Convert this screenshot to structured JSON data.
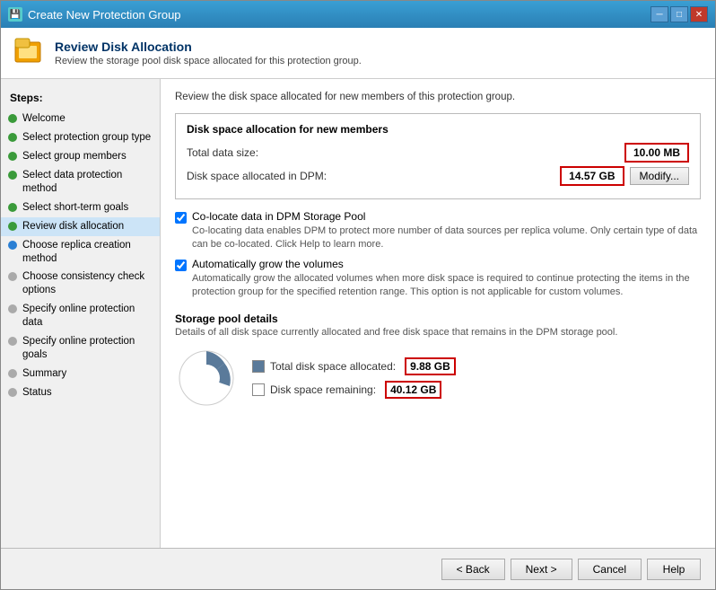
{
  "window": {
    "title": "Create New Protection Group",
    "icon": "💾"
  },
  "header": {
    "title": "Review Disk Allocation",
    "description": "Review the storage pool disk space allocated for this protection group."
  },
  "sidebar": {
    "steps_label": "Steps:",
    "items": [
      {
        "id": "welcome",
        "label": "Welcome",
        "dot": "green",
        "active": false
      },
      {
        "id": "select-protection-group-type",
        "label": "Select protection group type",
        "dot": "green",
        "active": false
      },
      {
        "id": "select-group-members",
        "label": "Select group members",
        "dot": "green",
        "active": false
      },
      {
        "id": "select-data-protection-method",
        "label": "Select data protection method",
        "dot": "green",
        "active": false
      },
      {
        "id": "select-short-term-goals",
        "label": "Select short-term goals",
        "dot": "green",
        "active": false
      },
      {
        "id": "review-disk-allocation",
        "label": "Review disk allocation",
        "dot": "green",
        "active": true
      },
      {
        "id": "choose-replica-creation-method",
        "label": "Choose replica creation method",
        "dot": "blue",
        "active": false
      },
      {
        "id": "choose-consistency-check-options",
        "label": "Choose consistency check options",
        "dot": "grey",
        "active": false
      },
      {
        "id": "specify-online-protection-data",
        "label": "Specify online protection data",
        "dot": "grey",
        "active": false
      },
      {
        "id": "specify-online-protection-goals",
        "label": "Specify online protection goals",
        "dot": "grey",
        "active": false
      },
      {
        "id": "summary",
        "label": "Summary",
        "dot": "grey",
        "active": false
      },
      {
        "id": "status",
        "label": "Status",
        "dot": "grey",
        "active": false
      }
    ]
  },
  "main": {
    "section_desc": "Review the disk space allocated for new members of this protection group.",
    "disk_box": {
      "title": "Disk space allocation for new members",
      "total_data_size_label": "Total data size:",
      "total_data_size_value": "10.00 MB",
      "disk_space_label": "Disk space allocated in DPM:",
      "disk_space_value": "14.57 GB",
      "modify_label": "Modify..."
    },
    "colocate_checkbox": {
      "label": "Co-locate data in DPM Storage Pool",
      "desc": "Co-locating data enables DPM to protect more number of data sources per replica volume. Only certain type of data can be co-located. Click Help to learn more.",
      "checked": true
    },
    "auto_grow_checkbox": {
      "label": "Automatically grow the volumes",
      "desc": "Automatically grow the allocated volumes when more disk space is required to continue protecting the items in the protection group for the specified retention range. This option is not applicable for custom volumes.",
      "checked": true
    },
    "storage_pool": {
      "title": "Storage pool details",
      "desc": "Details of all disk space currently allocated and free disk space that remains in the DPM storage pool.",
      "allocated_label": "Total disk space allocated:",
      "allocated_value": "9.88 GB",
      "remaining_label": "Disk space remaining:",
      "remaining_value": "40.12 GB"
    }
  },
  "footer": {
    "back_label": "< Back",
    "next_label": "Next >",
    "cancel_label": "Cancel",
    "help_label": "Help"
  }
}
